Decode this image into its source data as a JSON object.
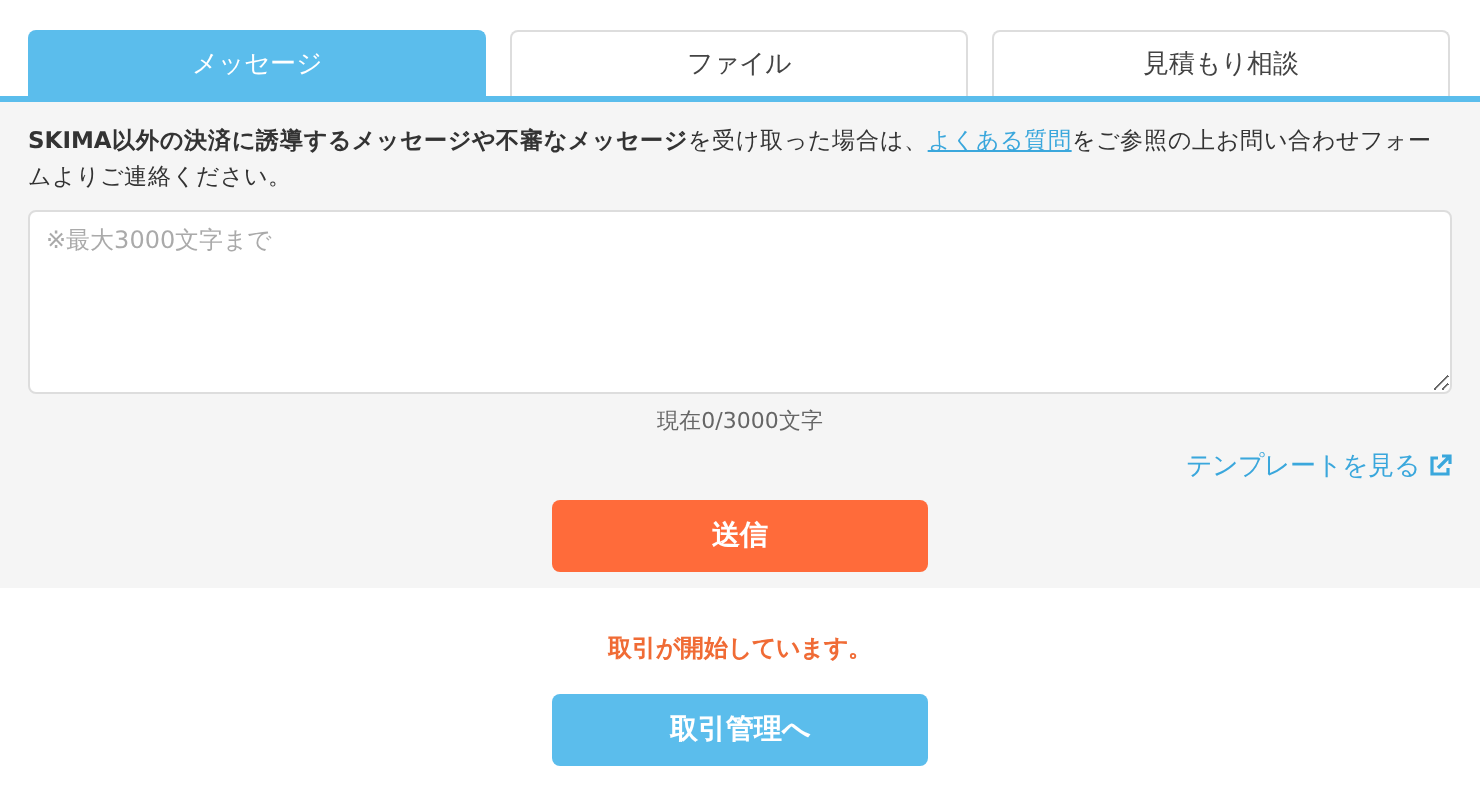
{
  "tabs": [
    {
      "label": "メッセージ",
      "selected": true
    },
    {
      "label": "ファイル",
      "selected": false
    },
    {
      "label": "見積もり相談",
      "selected": false
    }
  ],
  "notice": {
    "before": "**SKIMA以外の決済に誘導するメッセージや不審なメッセージ**を受け取った場合は、",
    "link": "よくある質問",
    "after": "をご参照の上お問い合わせフォームよりご連絡ください。"
  },
  "message_field": {
    "placeholder": "※最大3000文字まで"
  },
  "char_count": "現在0/3000文字",
  "template_link": "テンプレートを見る",
  "send_button": "送信",
  "status_message": "取引が開始しています。",
  "manage_button": "取引管理へ"
}
